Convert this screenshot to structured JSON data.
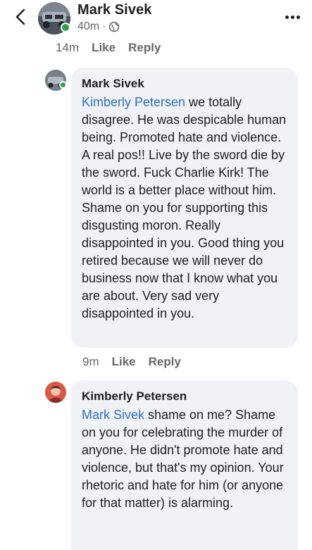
{
  "header": {
    "back_icon": "chevron-left-icon",
    "name": "Mark Sivek",
    "time": "40m",
    "separator": "·",
    "privacy_icon": "globe-icon",
    "more_icon": "more-horizontal-icon"
  },
  "top_actions": {
    "time": "14m",
    "like": "Like",
    "reply": "Reply"
  },
  "comments": [
    {
      "author": "Mark Sivek",
      "mention": "Kimberly Petersen",
      "text": " we totally disagree. He was despicable human being. Promoted hate and violence. A real pos!! Live by the sword die by the sword. Fuck Charlie Kirk! The world is a better place without him. Shame on you for supporting this disgusting moron. Really disappointed in you. Good thing you retired because we will never do business now that I know what you are about. Very sad very disappointed in you.",
      "time": "9m",
      "like": "Like",
      "reply": "Reply"
    },
    {
      "author": "Kimberly Petersen",
      "mention": "Mark Sivek",
      "text": " shame on me? Shame on you for celebrating the murder of anyone.  He didn't promote hate and violence, but that's my opinion. Your rhetoric and hate for him (or anyone for that matter) is alarming."
    }
  ],
  "colors": {
    "mention": "#2f6fbf",
    "bubble": "#f0f2f5",
    "meta": "#65676b",
    "online": "#31a24c"
  }
}
